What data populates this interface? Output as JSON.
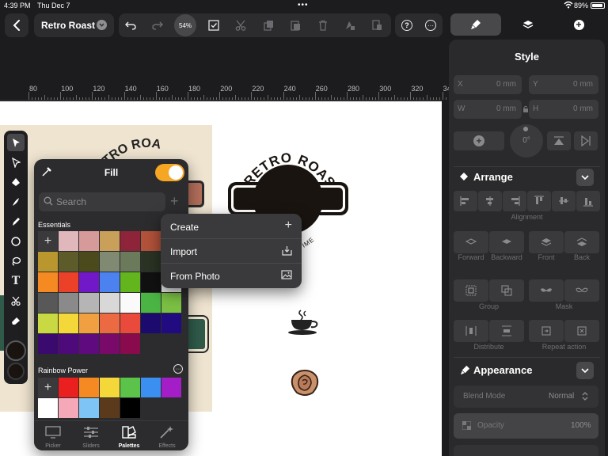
{
  "status": {
    "time": "4:39 PM",
    "date": "Thu Dec 7",
    "battery": "89%"
  },
  "toolbar": {
    "doc_name": "Retro Roast",
    "zoom": "54%",
    "icons": [
      "back-icon",
      "undo-icon",
      "redo-icon",
      "select-icon",
      "cut-icon",
      "copy-icon",
      "paste-icon",
      "delete-icon",
      "duplicate-icon",
      "stamp-icon",
      "help-icon",
      "more-icon"
    ]
  },
  "inspector_tabs": [
    "style-brush-icon",
    "layers-icon",
    "add-icon"
  ],
  "ruler": {
    "labels": [
      "80",
      "100",
      "120",
      "140",
      "160",
      "180",
      "200",
      "220",
      "240",
      "260",
      "280",
      "300",
      "320",
      "34"
    ]
  },
  "style": {
    "title": "Style",
    "x_label": "X",
    "x_value": "0 mm",
    "y_label": "Y",
    "y_value": "0 mm",
    "w_label": "W",
    "w_value": "0 mm",
    "h_label": "H",
    "h_value": "0 mm",
    "rotation": "0°"
  },
  "arrange": {
    "title": "Arrange",
    "alignment_label": "Alignment",
    "forward": "Forward",
    "backward": "Backward",
    "front": "Front",
    "back": "Back",
    "group": "Group",
    "mask": "Mask",
    "distribute": "Distribute",
    "repeat_action": "Repeat action"
  },
  "appearance": {
    "title": "Appearance",
    "blend_mode_label": "Blend Mode",
    "blend_mode_value": "Normal",
    "opacity_label": "Opacity",
    "opacity_value": "100%"
  },
  "fill_popup": {
    "title": "Fill",
    "toggle_on": true,
    "search_placeholder": "Search",
    "essentials_label": "Essentials",
    "rainbow_label": "Rainbow Power",
    "accent": "#f5a623",
    "essentials_colors": [
      [
        "#e0b7bb",
        "#d69a9b",
        "#c9a05a",
        "#8d2439",
        "#b2523a",
        "#2c2c2e"
      ],
      [
        "#b9962e",
        "#5e5b2a",
        "#4a4a1c",
        "#808a72",
        "#6b7a5a",
        "#2b3325",
        "#1e2a22"
      ],
      [
        "#f58a22",
        "#ea4128",
        "#7118c8",
        "#4b82f0",
        "#62b51c",
        "#111111",
        "#eeeeee"
      ],
      [
        "#585858",
        "#8a8a8a",
        "#b5b5b5",
        "#d8d8d8",
        "#fafafa",
        "#4bb544",
        "#7bc044"
      ],
      [
        "#c9d943",
        "#f4d83a",
        "#f0a040",
        "#ec6a41",
        "#ea4a3c",
        "#1c0a6e",
        "#220b80"
      ],
      [
        "#3a0a6e",
        "#4e0a7a",
        "#600a80",
        "#7a0a6a",
        "#8a0a4e",
        "#2c2c2e",
        "#2c2c2e"
      ]
    ],
    "rainbow_colors": [
      [
        "#ea1f1f",
        "#f58a22",
        "#f4d83a",
        "#5bc24a",
        "#3b8ff0",
        "#a41ec8"
      ],
      [
        "#ffffff",
        "#f5a8b8",
        "#7ec5f5",
        "#5a3a1a",
        "#000000",
        "#2c2c2e",
        "#2c2c2e"
      ]
    ],
    "bottom_tabs": [
      {
        "icon": "picker-icon",
        "label": "Picker"
      },
      {
        "icon": "sliders-icon",
        "label": "Sliders"
      },
      {
        "icon": "palettes-icon",
        "label": "Palettes"
      },
      {
        "icon": "effects-icon",
        "label": "Effects"
      }
    ]
  },
  "context_menu": {
    "items": [
      {
        "label": "Create",
        "icon": "plus-icon"
      },
      {
        "label": "Import",
        "icon": "import-icon"
      },
      {
        "label": "From Photo",
        "icon": "photo-icon"
      }
    ]
  },
  "canvas": {
    "logo_text": "RETRO ROAST",
    "partial_text_1": "TRO ROA",
    "partial_text_2": "TIME",
    "partial_text_3": "A TIME"
  }
}
